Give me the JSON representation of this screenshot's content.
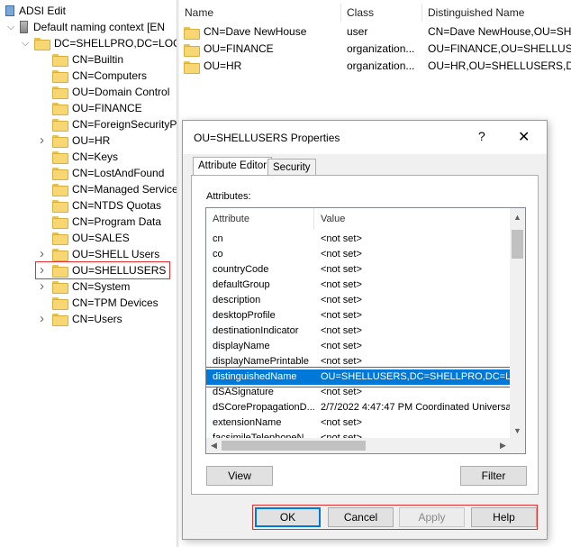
{
  "tree": {
    "root": "ADSI Edit",
    "context": "Default naming context [EN",
    "domain": "DC=SHELLPRO,DC=LOC",
    "items": [
      {
        "label": "CN=Builtin",
        "expandable": false
      },
      {
        "label": "CN=Computers",
        "expandable": false
      },
      {
        "label": "OU=Domain Control",
        "expandable": false
      },
      {
        "label": "OU=FINANCE",
        "expandable": false
      },
      {
        "label": "CN=ForeignSecurityP",
        "expandable": false
      },
      {
        "label": "OU=HR",
        "expandable": true
      },
      {
        "label": "CN=Keys",
        "expandable": false
      },
      {
        "label": "CN=LostAndFound",
        "expandable": false
      },
      {
        "label": "CN=Managed Service",
        "expandable": false
      },
      {
        "label": "CN=NTDS Quotas",
        "expandable": false
      },
      {
        "label": "CN=Program Data",
        "expandable": false
      },
      {
        "label": "OU=SALES",
        "expandable": false
      },
      {
        "label": "OU=SHELL Users",
        "expandable": true
      },
      {
        "label": "OU=SHELLUSERS",
        "expandable": true,
        "selected": true
      },
      {
        "label": "CN=System",
        "expandable": true
      },
      {
        "label": "CN=TPM Devices",
        "expandable": false
      },
      {
        "label": "CN=Users",
        "expandable": true
      }
    ]
  },
  "list": {
    "headers": [
      "Name",
      "Class",
      "Distinguished Name"
    ],
    "rows": [
      {
        "name": "CN=Dave NewHouse",
        "class": "user",
        "dn": "CN=Dave NewHouse,OU=SHE"
      },
      {
        "name": "OU=FINANCE",
        "class": "organization...",
        "dn": "OU=FINANCE,OU=SHELLUSER"
      },
      {
        "name": "OU=HR",
        "class": "organization...",
        "dn": "OU=HR,OU=SHELLUSERS,DC="
      }
    ]
  },
  "dialog": {
    "title": "OU=SHELLUSERS Properties",
    "help": "?",
    "close": "✕",
    "tabs": [
      "Attribute Editor",
      "Security"
    ],
    "attributes_label": "Attributes:",
    "grid_headers": [
      "Attribute",
      "Value"
    ],
    "rows": [
      {
        "attr": "cn",
        "value": "<not set>"
      },
      {
        "attr": "co",
        "value": "<not set>"
      },
      {
        "attr": "countryCode",
        "value": "<not set>"
      },
      {
        "attr": "defaultGroup",
        "value": "<not set>"
      },
      {
        "attr": "description",
        "value": "<not set>"
      },
      {
        "attr": "desktopProfile",
        "value": "<not set>"
      },
      {
        "attr": "destinationIndicator",
        "value": "<not set>"
      },
      {
        "attr": "displayName",
        "value": "<not set>"
      },
      {
        "attr": "displayNamePrintable",
        "value": "<not set>"
      },
      {
        "attr": "distinguishedName",
        "value": "OU=SHELLUSERS,DC=SHELLPRO,DC=LOC",
        "selected": true
      },
      {
        "attr": "dSASignature",
        "value": "<not set>"
      },
      {
        "attr": "dSCorePropagationD...",
        "value": "2/7/2022 4:47:47 PM Coordinated Universal"
      },
      {
        "attr": "extensionName",
        "value": "<not set>"
      },
      {
        "attr": "facsimileTelephoneN...",
        "value": "<not set>"
      }
    ],
    "view_button": "View",
    "filter_button": "Filter",
    "ok_button": "OK",
    "cancel_button": "Cancel",
    "apply_button": "Apply",
    "help_button": "Help"
  },
  "colors": {
    "selection": "#0078d7",
    "highlight_box": "#e03030",
    "dialog_bg": "#f0f0f0"
  }
}
